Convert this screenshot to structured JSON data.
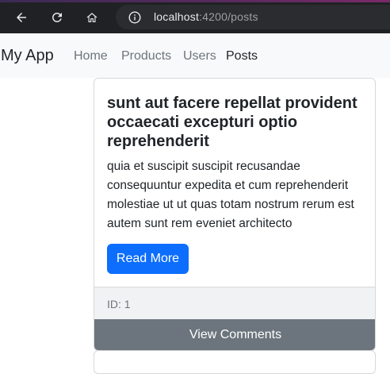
{
  "browser": {
    "url_host": "localhost",
    "url_path": ":4200/posts",
    "icons": [
      "back-arrow-icon",
      "reload-icon",
      "home-icon",
      "info-icon"
    ]
  },
  "navbar": {
    "brand": "My App",
    "links": [
      {
        "label": "Home"
      },
      {
        "label": "Products"
      },
      {
        "label": "Users"
      },
      {
        "label": "Posts",
        "active": true
      }
    ]
  },
  "post": {
    "title": "sunt aut facere repellat provident occaecati excepturi optio reprehenderit",
    "body": "quia et suscipit suscipit recusandae consequuntur expedita et cum reprehenderit molestiae ut ut quas totam nostrum rerum est autem sunt rem eveniet architecto",
    "read_more_label": "Read More",
    "id_label": "ID: 1",
    "view_comments_label": "View Comments"
  },
  "colors": {
    "primary": "#0d6efd",
    "secondary": "#6c757d",
    "navbar_bg": "#f8f9fa",
    "browser_bg": "#202124"
  }
}
